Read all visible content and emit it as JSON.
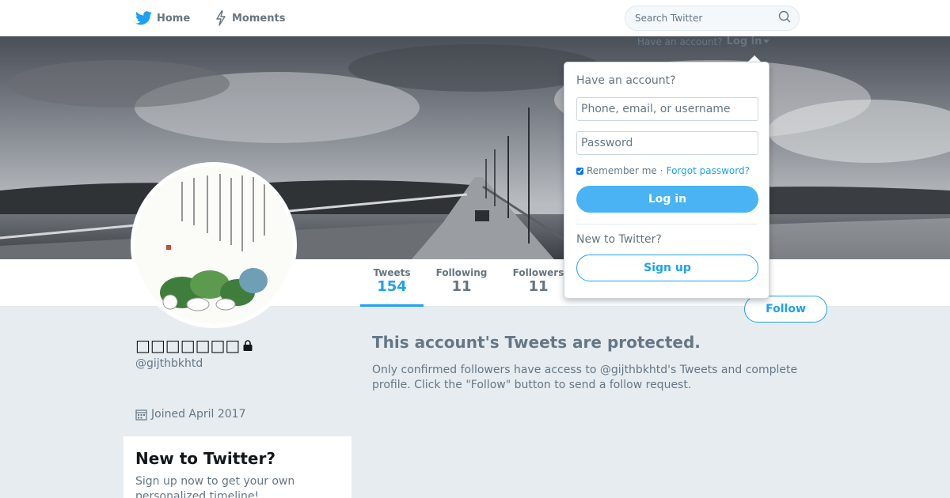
{
  "nav": {
    "home_label": "Home",
    "moments_label": "Moments"
  },
  "search": {
    "placeholder": "Search Twitter"
  },
  "login_prompt": {
    "text": "Have an account?",
    "login_label": "Log in"
  },
  "profile": {
    "name": "□□□□□□□",
    "handle": "@gijthbkhtd",
    "joined": "Joined April 2017"
  },
  "stats": [
    {
      "label": "Tweets",
      "value": "154"
    },
    {
      "label": "Following",
      "value": "11"
    },
    {
      "label": "Followers",
      "value": "11"
    }
  ],
  "follow_button": "Follow",
  "protected": {
    "title": "This account's Tweets are protected.",
    "body": "Only confirmed followers have access to @gijthbkhtd's Tweets and complete profile. Click the \"Follow\" button to send a follow request."
  },
  "signup_box": {
    "title": "New to Twitter?",
    "body": "Sign up now to get your own personalized timeline!"
  },
  "login_dropdown": {
    "heading": "Have an account?",
    "username_placeholder": "Phone, email, or username",
    "password_placeholder": "Password",
    "remember_label": "Remember me",
    "separator": "·",
    "forgot_label": "Forgot password?",
    "login_button": "Log in",
    "new_heading": "New to Twitter?",
    "signup_button": "Sign up"
  },
  "colors": {
    "brand": "#1da1f2",
    "background": "#e6ecf0"
  }
}
